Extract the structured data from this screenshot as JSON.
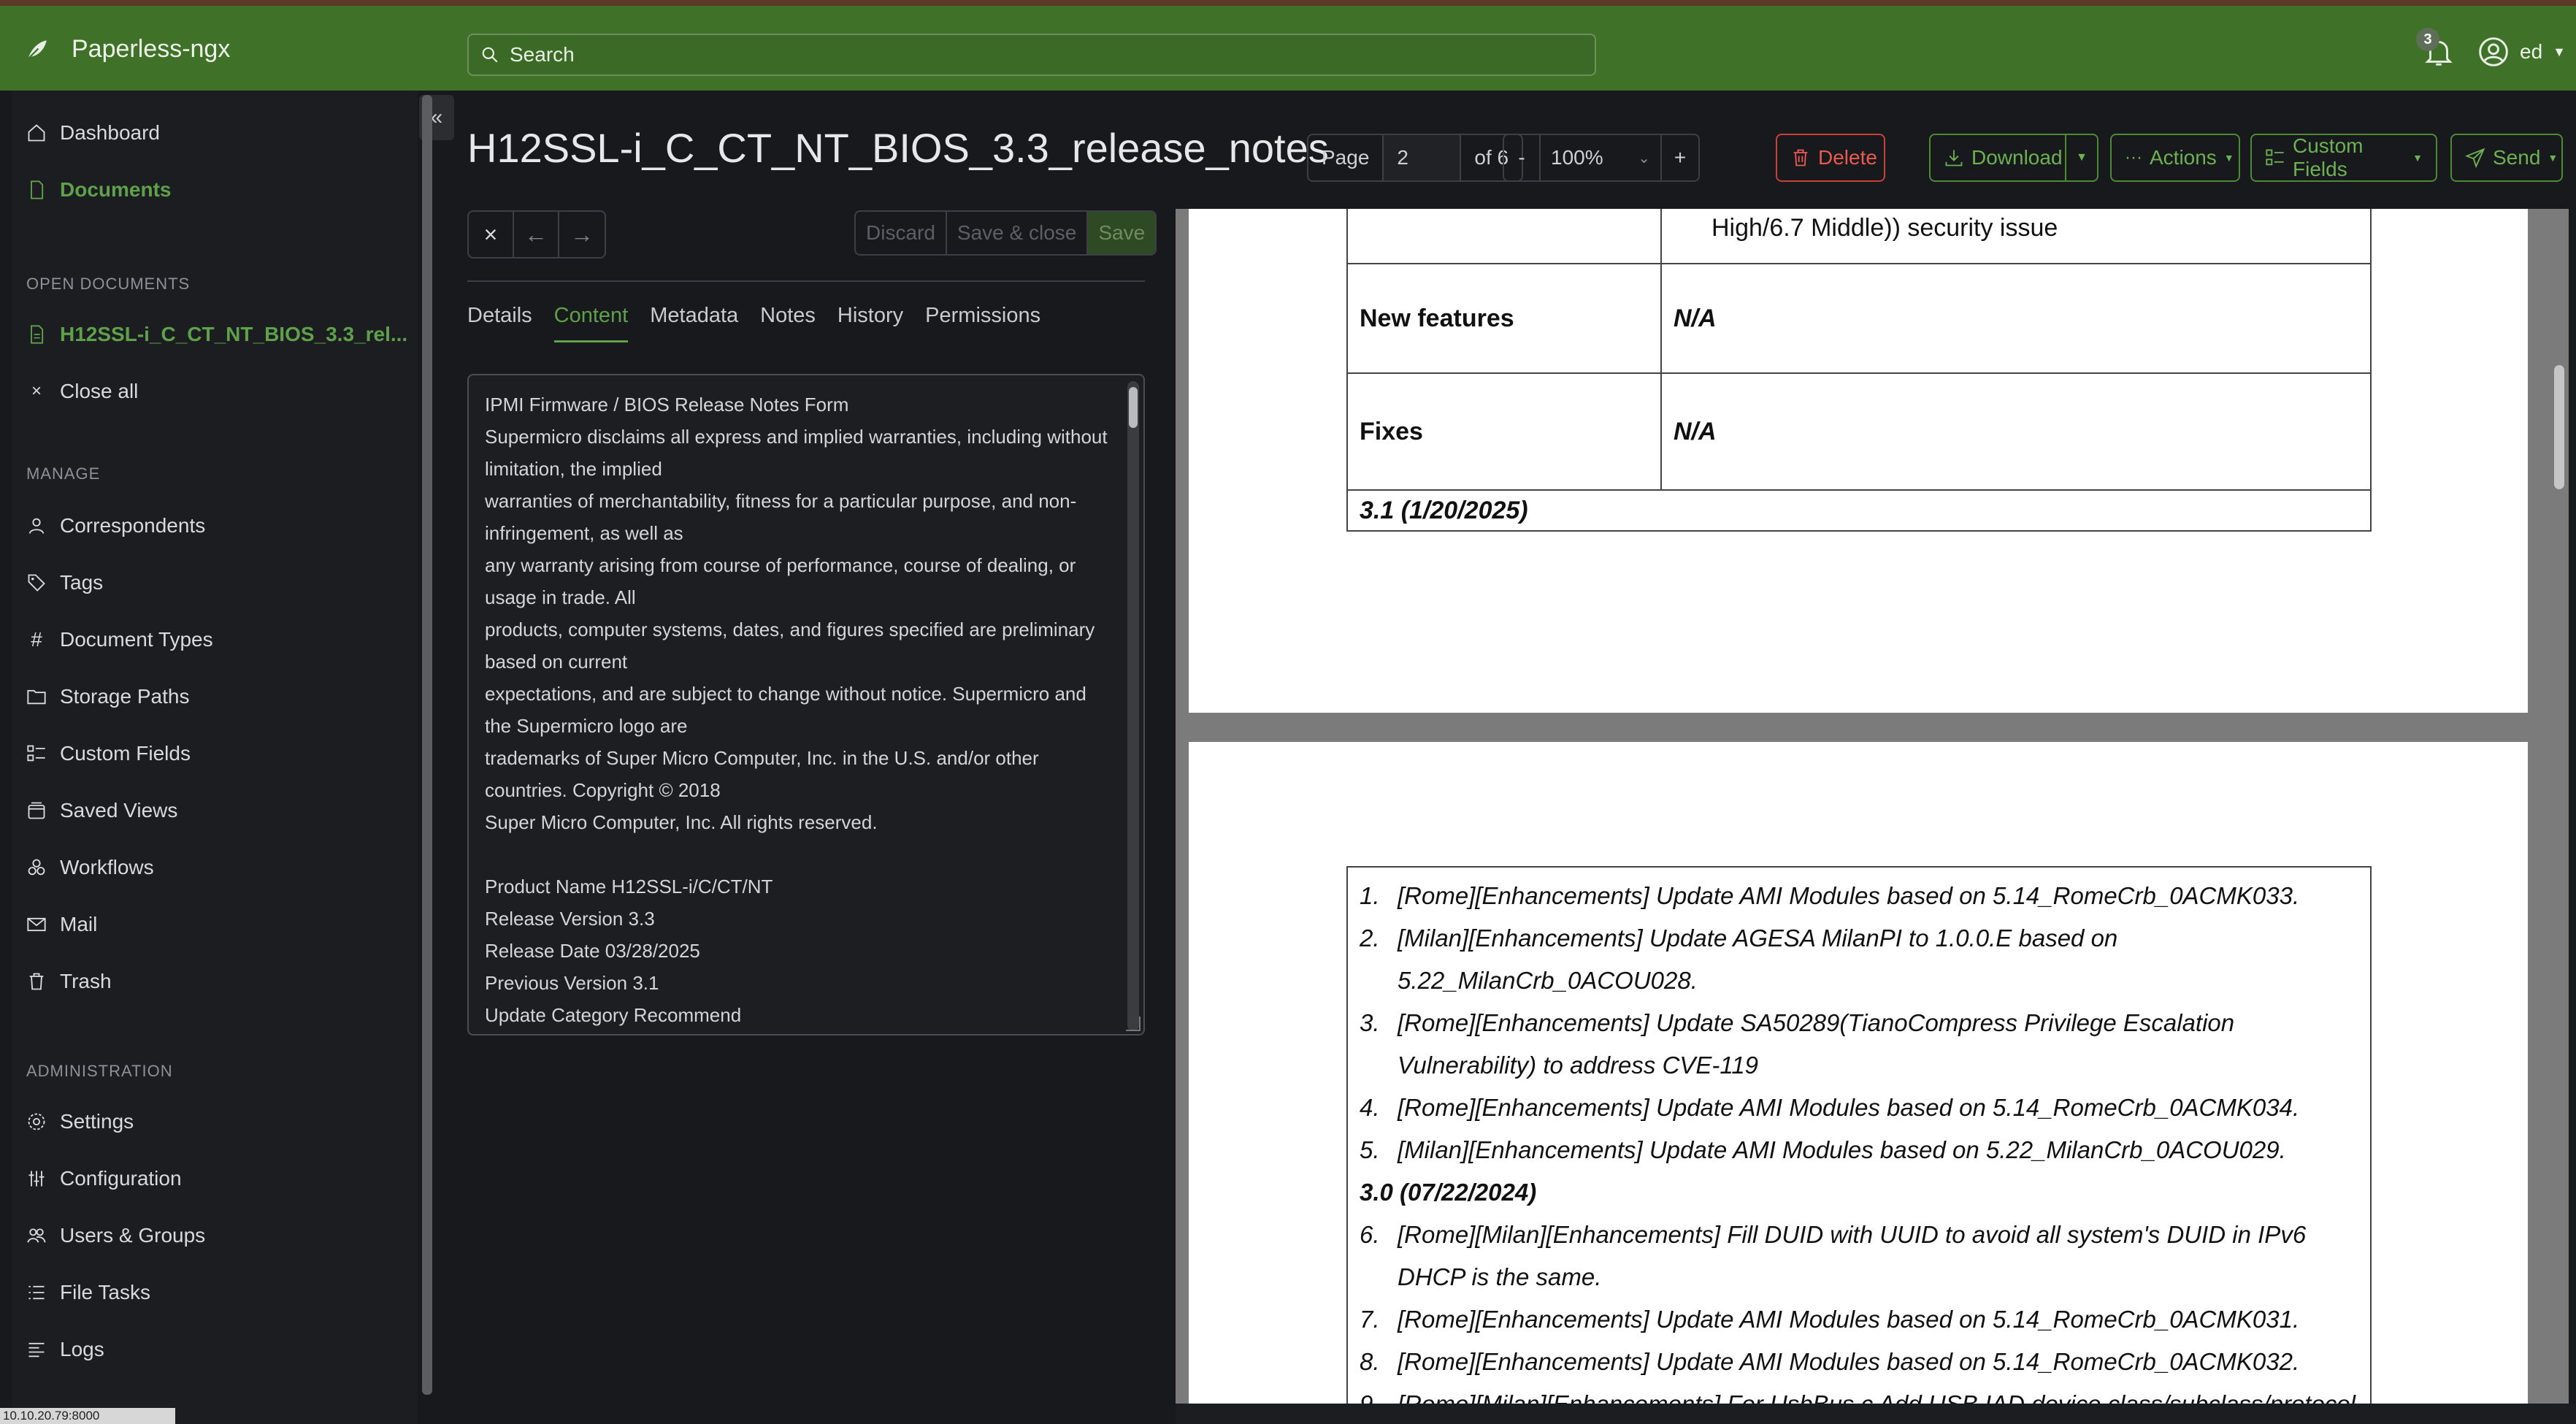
{
  "app": {
    "name": "Paperless-ngx",
    "user": "ed",
    "notification_count": "3"
  },
  "search": {
    "placeholder": "Search"
  },
  "sidebar": {
    "dashboard": "Dashboard",
    "documents": "Documents",
    "open_heading": "OPEN DOCUMENTS",
    "open_doc": "H12SSL-i_C_CT_NT_BIOS_3.3_rel...",
    "close_all": "Close all",
    "manage_heading": "MANAGE",
    "manage": [
      "Correspondents",
      "Tags",
      "Document Types",
      "Storage Paths",
      "Custom Fields",
      "Saved Views",
      "Workflows",
      "Mail",
      "Trash"
    ],
    "admin_heading": "ADMINISTRATION",
    "admin": [
      "Settings",
      "Configuration",
      "Users & Groups",
      "File Tasks",
      "Logs"
    ],
    "footer_status": "10.10.20.79:8000"
  },
  "document": {
    "title": "H12SSL-i_C_CT_NT_BIOS_3.3_release_notes",
    "page_label": "Page",
    "page_value": "2",
    "page_total": "of 6",
    "zoom_minus": "-",
    "zoom_value": "100%",
    "zoom_plus": "+"
  },
  "toolbar": {
    "delete": "Delete",
    "download": "Download",
    "actions": "Actions",
    "custom_fields": "Custom Fields",
    "send": "Send",
    "discard": "Discard",
    "save_close": "Save & close",
    "save": "Save"
  },
  "tabs": [
    "Details",
    "Content",
    "Metadata",
    "Notes",
    "History",
    "Permissions"
  ],
  "content_lines": [
    "IPMI Firmware / BIOS Release Notes Form",
    "Supermicro disclaims all express and implied warranties, including without limitation, the implied",
    "warranties of merchantability, fitness for a particular purpose, and non-infringement, as well as",
    "any warranty arising from course of performance, course of dealing, or usage in trade. All",
    "products, computer systems, dates, and figures specified are preliminary based on current",
    "expectations, and are subject to change without notice. Supermicro and the Supermicro logo are",
    "trademarks of Super Micro Computer, Inc. in the U.S. and/or other countries. Copyright © 2018",
    "Super Micro Computer, Inc. All rights reserved.",
    "",
    "Product Name H12SSL-i/C/CT/NT",
    "Release Version 3.3",
    "Release Date 03/28/2025",
    "Previous Version 3.1",
    "Update Category Recommend"
  ],
  "pdf": {
    "top_line": "High/6.7 Middle)) security issue",
    "new_features_label": "New features",
    "new_features_value": "N/A",
    "fixes_label": "Fixes",
    "fixes_value": "N/A",
    "version_31": "3.1 (1/20/2025)",
    "items": [
      {
        "num": "1.",
        "text": "[Rome][Enhancements] Update AMI Modules based on 5.14_RomeCrb_0ACMK033."
      },
      {
        "num": "2.",
        "text": "[Milan][Enhancements] Update AGESA MilanPI to 1.0.0.E based on"
      },
      {
        "num": "",
        "text": "5.22_MilanCrb_0ACOU028."
      },
      {
        "num": "3.",
        "text": "[Rome][Enhancements] Update SA50289(TianoCompress Privilege Escalation"
      },
      {
        "num": "",
        "text": "Vulnerability) to address CVE-119"
      },
      {
        "num": "4.",
        "text": "[Rome][Enhancements] Update AMI Modules based on 5.14_RomeCrb_0ACMK034."
      },
      {
        "num": "5.",
        "text": "[Milan][Enhancements] Update AMI Modules based on 5.22_MilanCrb_0ACOU029."
      }
    ],
    "version_30": "3.0 (07/22/2024)",
    "items2": [
      {
        "num": "6.",
        "text": "[Rome][Milan][Enhancements] Fill DUID with UUID to avoid all system's DUID in IPv6"
      },
      {
        "num": "",
        "text": "DHCP is the same."
      },
      {
        "num": "7.",
        "text": "[Rome][Enhancements] Update AMI Modules based on 5.14_RomeCrb_0ACMK031."
      },
      {
        "num": "8.",
        "text": "[Rome][Enhancements] Update AMI Modules based on 5.14_RomeCrb_0ACMK032."
      },
      {
        "num": "9.",
        "text": "[Rome][Milan][Enhancements] For UsbBus.c Add USB IAD device class/subclass/protocol"
      }
    ]
  }
}
